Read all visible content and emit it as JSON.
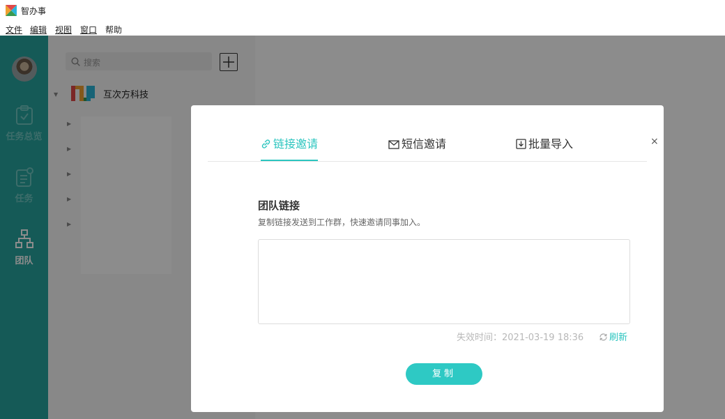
{
  "window": {
    "title": "智办事"
  },
  "menu": {
    "items": [
      {
        "label": "文件"
      },
      {
        "label": "编辑"
      },
      {
        "label": "视图"
      },
      {
        "label": "窗口"
      },
      {
        "label": "帮助"
      }
    ]
  },
  "nav": {
    "items": [
      {
        "label": "任务总览",
        "icon": "clipboard-check-icon",
        "active": false
      },
      {
        "label": "任务",
        "icon": "task-list-icon",
        "active": false
      },
      {
        "label": "团队",
        "icon": "org-chart-icon",
        "active": true
      }
    ]
  },
  "panel": {
    "search_placeholder": "搜索",
    "org": {
      "name": "互次方科技"
    }
  },
  "modal": {
    "tabs": [
      {
        "label": "链接邀请",
        "icon": "link-icon",
        "active": true
      },
      {
        "label": "短信邀请",
        "icon": "mail-icon",
        "active": false
      },
      {
        "label": "批量导入",
        "icon": "import-icon",
        "active": false
      }
    ],
    "close": "×",
    "section_title": "团队链接",
    "section_desc": "复制链接发送到工作群，快速邀请同事加入。",
    "link_value": "",
    "expire_label": "失效时间：",
    "expire_time": "2021-03-19 18:36",
    "refresh_label": "刷新",
    "copy_label": "复制"
  },
  "colors": {
    "accent": "#2bc5bf",
    "nav_bg": "#27a49f"
  }
}
